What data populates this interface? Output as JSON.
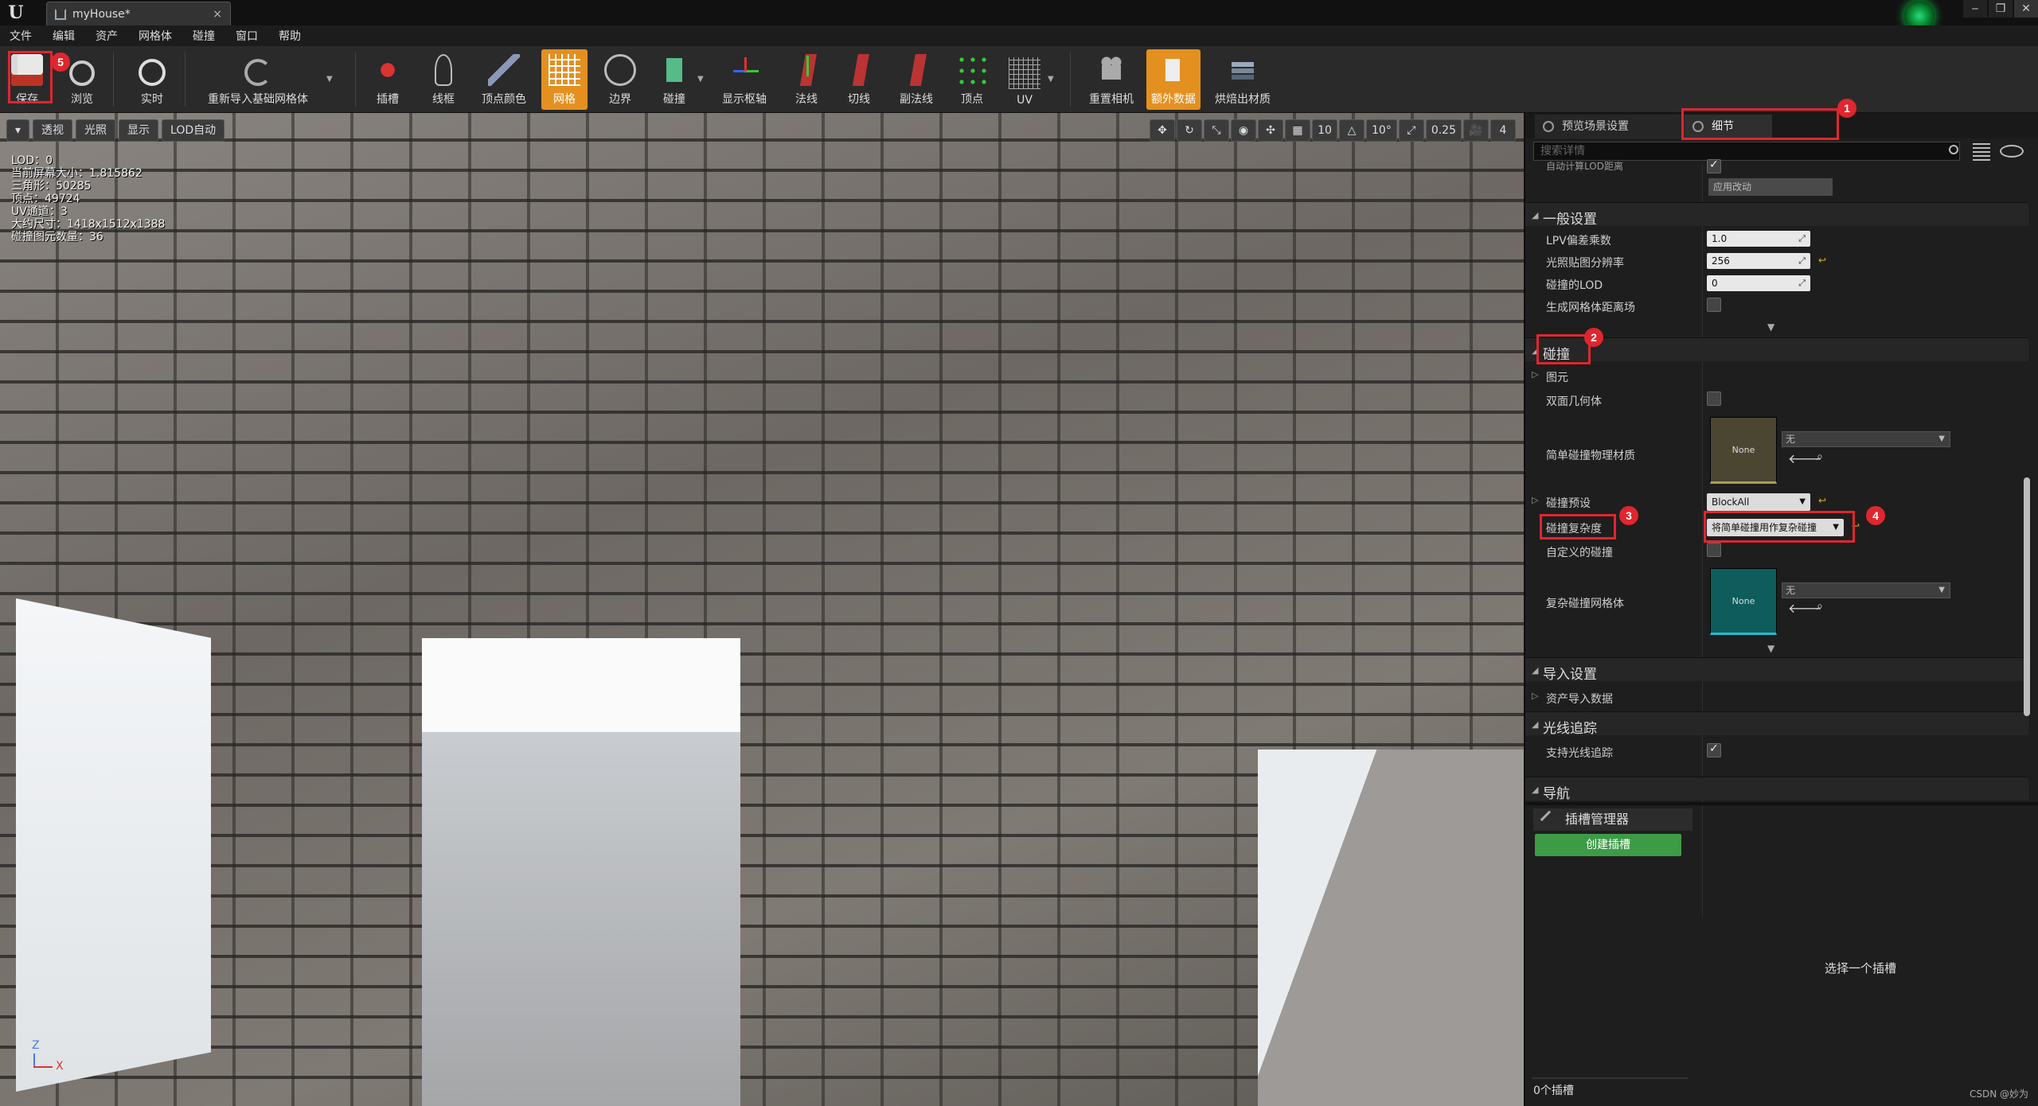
{
  "window": {
    "tab_title": "myHouse*"
  },
  "menu": [
    "文件",
    "编辑",
    "资产",
    "网格体",
    "碰撞",
    "窗口",
    "帮助"
  ],
  "toolbar": {
    "save": "保存",
    "browse": "浏览",
    "realtime": "实时",
    "reimport": "重新导入基础网格体",
    "sockets": "插槽",
    "wireframe": "线框",
    "vertex_color": "顶点颜色",
    "mesh": "网格",
    "bounds": "边界",
    "collision": "碰撞",
    "pivot": "显示枢轴",
    "normals": "法线",
    "tangents": "切线",
    "binormals": "副法线",
    "vertices": "顶点",
    "uv": "UV",
    "reset_camera": "重置相机",
    "extra_data": "额外数据",
    "bake_material": "烘焙出材质"
  },
  "viewport": {
    "buttons": {
      "perspective": "透视",
      "lit": "光照",
      "show": "显示",
      "lod": "LOD自动"
    },
    "right_controls": [
      "10",
      "10°",
      "0.25",
      "4"
    ],
    "stats": [
      "LOD：0",
      "当前屏幕大小：1.815862",
      "三角形：50285",
      "顶点：49724",
      "UV通道：3",
      "大约尺寸：1418x1512x1388",
      "碰撞图元数量：36"
    ],
    "axis": {
      "z": "Z",
      "x": "X"
    }
  },
  "details": {
    "tabs": {
      "preview": "预览场景设置",
      "details": "细节"
    },
    "search_placeholder": "搜索详情",
    "top_cut_label": "自动计算LOD距离",
    "apply_changes": "应用改动",
    "sections": {
      "general": "一般设置",
      "collision": "碰撞",
      "import": "导入设置",
      "raytracing": "光线追踪",
      "navigation": "导航"
    },
    "general_rows": [
      {
        "label": "LPV偏差乘数",
        "value": "1.0"
      },
      {
        "label": "光照贴图分辨率",
        "value": "256"
      },
      {
        "label": "碰撞的LOD",
        "value": "0"
      },
      {
        "label": "生成网格体距离场",
        "value": ""
      }
    ],
    "collision_rows": {
      "primitives": "图元",
      "double_sided": "双面几何体",
      "simple_phys_mat": "简单碰撞物理材质",
      "none": "None",
      "none_option": "无",
      "preset_label": "碰撞预设",
      "preset_value": "BlockAll",
      "complexity_label": "碰撞复杂度",
      "complexity_value": "将简单碰撞用作复杂碰撞",
      "custom": "自定义的碰撞",
      "complex_mesh": "复杂碰撞网格体"
    },
    "import_rows": {
      "asset_import_data": "资产导入数据"
    },
    "raytracing_rows": {
      "support": "支持光线追踪"
    }
  },
  "sockets": {
    "tab": "插槽管理器",
    "create": "创建插槽",
    "select_hint": "选择一个插槽",
    "count": "0个插槽"
  },
  "annotations": [
    "1",
    "2",
    "3",
    "4",
    "5"
  ],
  "watermark": "CSDN @妙为",
  "colors": {
    "accent": "#e49021",
    "highlight": "#e0262e",
    "green": "#3d9b46"
  }
}
